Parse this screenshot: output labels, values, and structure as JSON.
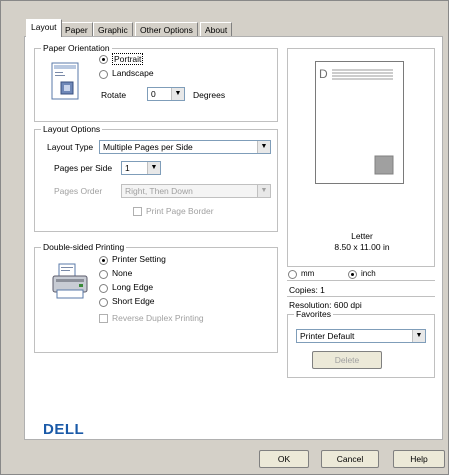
{
  "tabs": [
    "Layout",
    "Paper",
    "Graphic",
    "Other Options",
    "About"
  ],
  "orientation": {
    "legend": "Paper Orientation",
    "portrait": "Portrait",
    "landscape": "Landscape",
    "rotate_label": "Rotate",
    "rotate_value": "0",
    "degrees": "Degrees"
  },
  "layout_options": {
    "legend": "Layout Options",
    "type_label": "Layout Type",
    "type_value": "Multiple Pages per Side",
    "pps_label": "Pages per Side",
    "pps_value": "1",
    "order_label": "Pages Order",
    "order_value": "Right, Then Down",
    "border_label": "Print Page Border"
  },
  "duplex": {
    "legend": "Double-sided Printing",
    "options": [
      "Printer Setting",
      "None",
      "Long Edge",
      "Short Edge"
    ],
    "reverse_label": "Reverse Duplex Printing"
  },
  "preview": {
    "letter_glyph": "D",
    "paper_name": "Letter",
    "paper_size": "8.50 x 11.00 in",
    "unit_mm": "mm",
    "unit_inch": "inch",
    "copies": "Copies: 1",
    "resolution": "Resolution: 600 dpi"
  },
  "favorites": {
    "legend": "Favorites",
    "value": "Printer Default",
    "delete_label": "Delete"
  },
  "logo_text": "DELL",
  "buttons": {
    "ok": "OK",
    "cancel": "Cancel",
    "help": "Help"
  }
}
